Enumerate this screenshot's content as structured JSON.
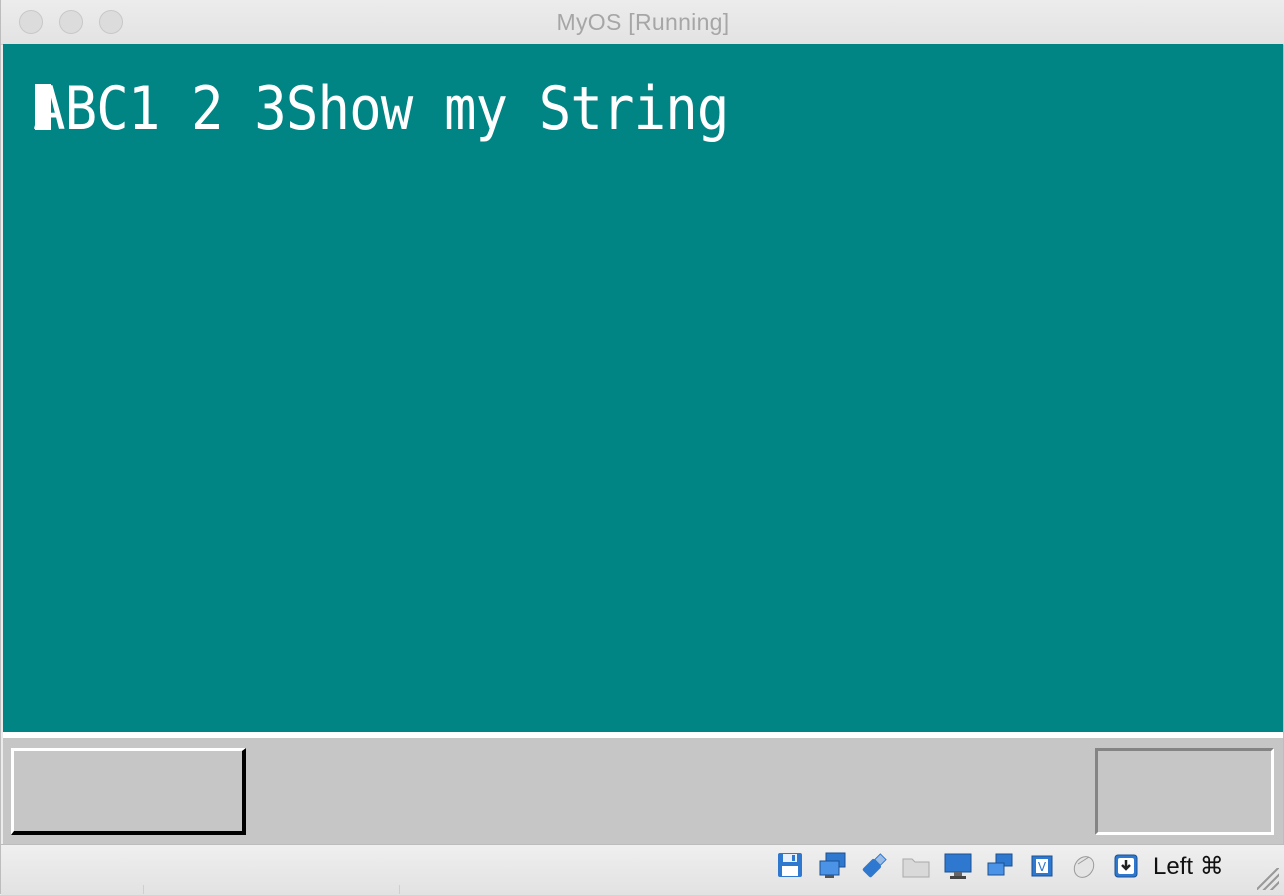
{
  "window": {
    "title": "MyOS [Running]"
  },
  "vm_screen": {
    "background_color": "#008484",
    "text_color": "#ffffff",
    "text_line": "ABC1 2 3Show my String"
  },
  "guest_taskbar": {
    "background_color": "#c6c6c6"
  },
  "statusbar": {
    "icons": [
      "floppy-disk-icon",
      "network-adapter-icon",
      "usb-icon",
      "shared-folders-icon",
      "display-icon",
      "video-capture-icon",
      "cpu-virtualization-icon",
      "mouse-integration-icon",
      "keyboard-capture-icon"
    ],
    "host_key": "Left ⌘"
  }
}
